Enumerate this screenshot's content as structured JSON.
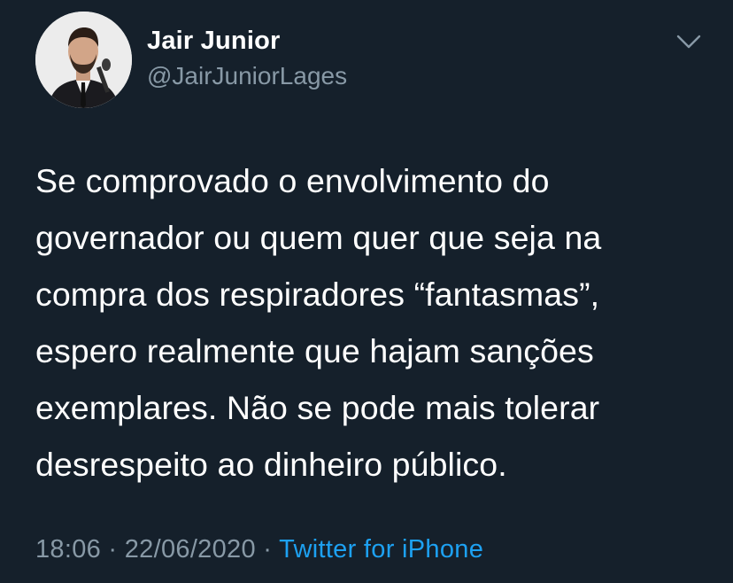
{
  "colors": {
    "background": "#15202b",
    "text_primary": "#ffffff",
    "text_secondary": "#8899a6",
    "link": "#1da1f2"
  },
  "author": {
    "display_name": "Jair Junior",
    "handle": "@JairJuniorLages",
    "avatar_icon": "profile-photo"
  },
  "menu": {
    "icon": "chevron-down-icon"
  },
  "tweet": {
    "lines": [
      "Se comprovado o envolvimento do",
      "governador ou quem quer que seja na",
      "compra dos respiradores “fantasmas”,",
      "espero realmente que hajam sanções",
      "exemplares. Não se pode mais tolerar",
      "desrespeito ao dinheiro público."
    ]
  },
  "meta": {
    "time": "18:06",
    "separator": " · ",
    "date": "22/06/2020",
    "source": "Twitter for iPhone"
  }
}
